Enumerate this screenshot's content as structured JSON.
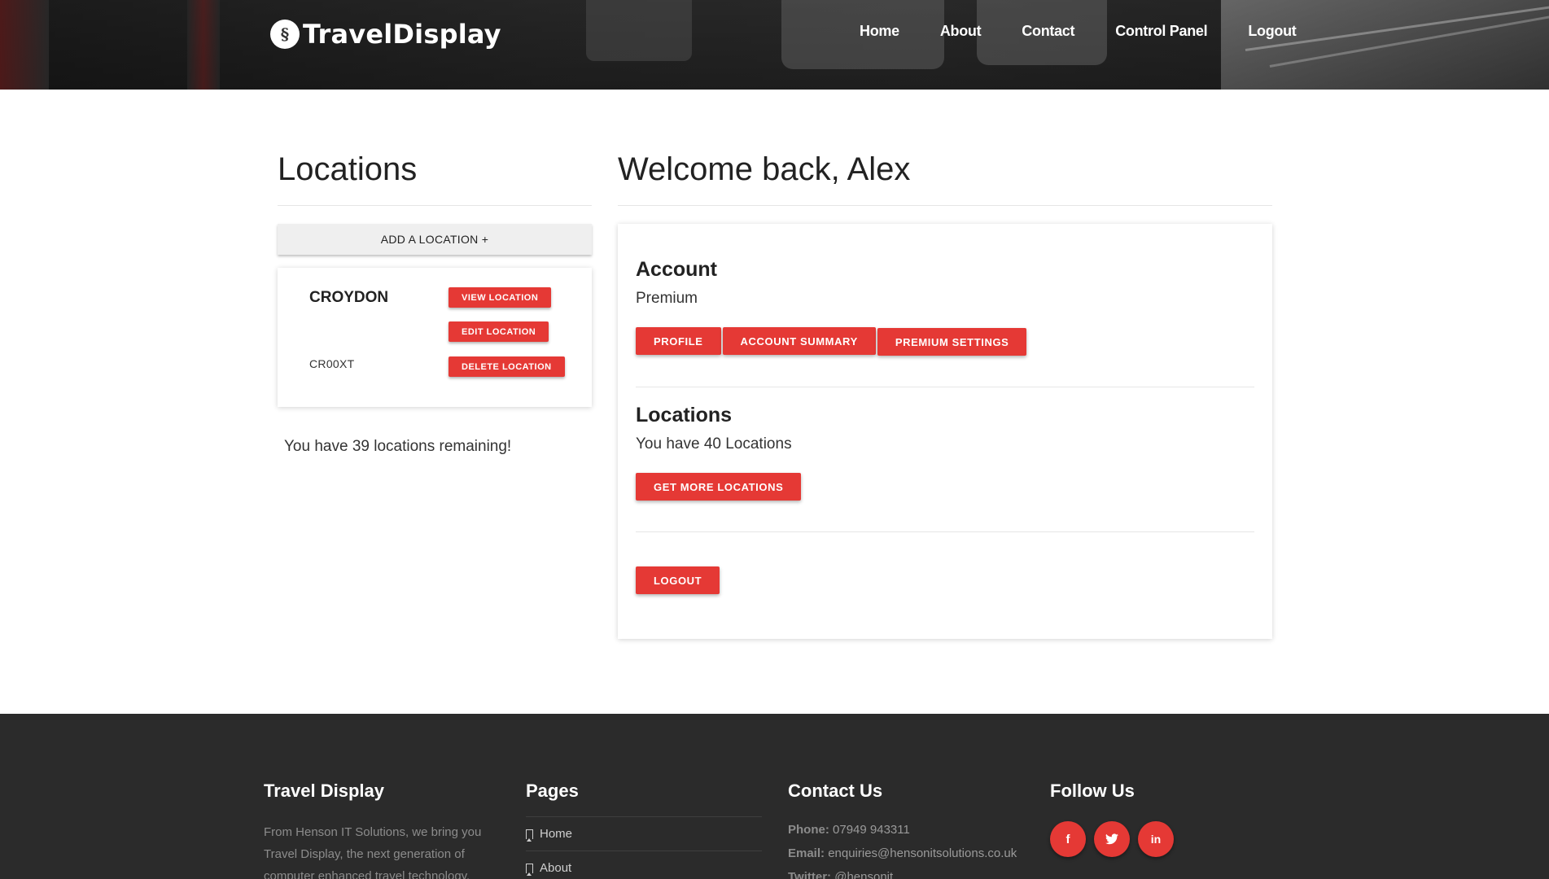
{
  "brand": {
    "name": "TravelDisplay",
    "logo_icon": "traveldisplay-logo-icon"
  },
  "nav": {
    "items": [
      {
        "label": "Home"
      },
      {
        "label": "About"
      },
      {
        "label": "Contact"
      },
      {
        "label": "Control Panel"
      },
      {
        "label": "Logout"
      }
    ]
  },
  "locations_panel": {
    "title": "Locations",
    "add_button": "ADD A LOCATION +",
    "location": {
      "name": "CROYDON",
      "code": "CR00XT",
      "view_button": "VIEW LOCATION",
      "edit_button": "EDIT LOCATION",
      "delete_button": "DELETE LOCATION"
    },
    "remaining_text": "You have 39 locations remaining!"
  },
  "dashboard": {
    "welcome": "Welcome back, Alex",
    "account": {
      "title": "Account",
      "plan": "Premium",
      "buttons": {
        "profile": "PROFILE",
        "summary": "ACCOUNT SUMMARY",
        "premium": "PREMIUM SETTINGS"
      }
    },
    "locations": {
      "title": "Locations",
      "count_text": "You have 40 Locations",
      "more_button": "GET MORE LOCATIONS"
    },
    "logout_button": "LOGOUT"
  },
  "footer": {
    "about": {
      "title": "Travel Display",
      "text": "From Henson IT Solutions, we bring you Travel Display, the next generation of computer enhanced travel technology."
    },
    "pages": {
      "title": "Pages",
      "links": [
        {
          "label": "Home"
        },
        {
          "label": "About"
        }
      ]
    },
    "contact": {
      "title": "Contact Us",
      "phone_label": "Phone:",
      "phone": "07949 943311",
      "email_label": "Email:",
      "email": "enquiries@hensonitsolutions.co.uk",
      "twitter_label": "Twitter:",
      "twitter": "@hensonit"
    },
    "follow": {
      "title": "Follow Us",
      "icons": [
        "facebook-icon",
        "twitter-icon",
        "linkedin-icon"
      ]
    }
  },
  "colors": {
    "accent": "#e53935",
    "footer_bg": "#2b2b2b",
    "header_text": "#ffffff"
  }
}
